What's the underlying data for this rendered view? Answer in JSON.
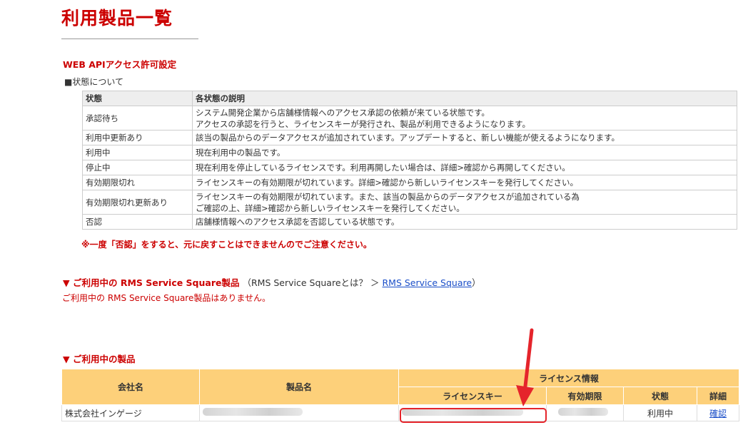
{
  "page": {
    "title": "利用製品一覧"
  },
  "webapi": {
    "section_title": "WEB APIアクセス許可設定",
    "status_about": "■状態について",
    "headers": {
      "status": "状態",
      "description": "各状態の説明"
    },
    "rows": [
      {
        "status": "承認待ち",
        "lines": [
          "システム開発企業から店舗様情報へのアクセス承認の依頼が来ている状態です。",
          "アクセスの承認を行うと、ライセンスキーが発行され、製品が利用できるようになります。"
        ]
      },
      {
        "status": "利用中更新あり",
        "lines": [
          "該当の製品からのデータアクセスが追加されています。アップデートすると、新しい機能が使えるようになります。"
        ]
      },
      {
        "status": "利用中",
        "lines": [
          "現在利用中の製品です。"
        ]
      },
      {
        "status": "停止中",
        "lines": [
          "現在利用を停止しているライセンスです。利用再開したい場合は、詳細>確認から再開してください。"
        ]
      },
      {
        "status": "有効期限切れ",
        "lines": [
          "ライセンスキーの有効期限が切れています。詳細>確認から新しいライセンスキーを発行してください。"
        ]
      },
      {
        "status": "有効期限切れ更新あり",
        "lines": [
          "ライセンスキーの有効期限が切れています。また、該当の製品からのデータアクセスが追加されている為",
          "ご確認の上、詳細>確認から新しいライセンスキーを発行してください。"
        ]
      },
      {
        "status": "否認",
        "lines": [
          "店舗様情報へのアクセス承認を否認している状態です。"
        ]
      }
    ],
    "warning": "※一度「否認」をすると、元に戻すことはできませんのでご注意ください。"
  },
  "rms": {
    "section_title": "▼ ご利用中の RMS Service Square製品",
    "paren_prefix": "（RMS Service Squareとは？ ＞ ",
    "link_label": "RMS Service Square",
    "paren_suffix": "）",
    "empty_message": "ご利用中の RMS Service Square製品はありません。"
  },
  "products": {
    "section_title": "▼ ご利用中の製品",
    "headers": {
      "company": "会社名",
      "product": "製品名",
      "license_info": "ライセンス情報",
      "license_key": "ライセンスキー",
      "expiry": "有効期限",
      "status": "状態",
      "detail": "詳細"
    },
    "rows": [
      {
        "company": "株式会社インゲージ",
        "status": "利用中",
        "detail_link": "確認"
      }
    ]
  },
  "colors": {
    "accent": "#cc0000",
    "header_bg": "#fdd07a",
    "link": "#1a4ec8",
    "status_active": "#2a8a2a",
    "highlight": "#e5242b"
  }
}
